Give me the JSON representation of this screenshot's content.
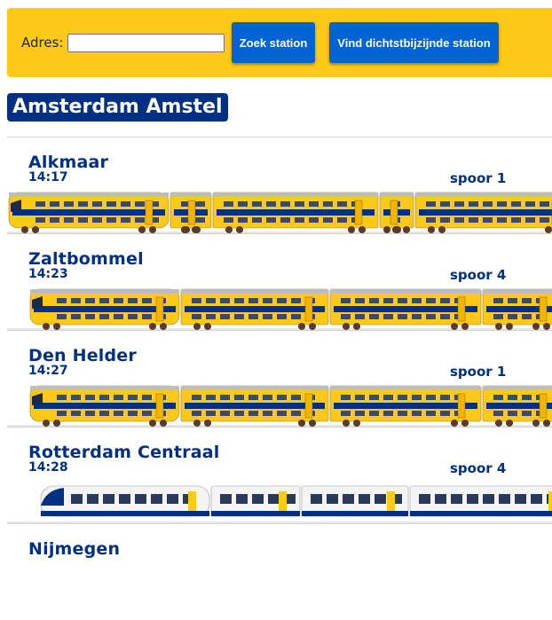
{
  "search": {
    "label": "Adres:",
    "input_value": "",
    "placeholder": "",
    "search_button": "Zoek station",
    "nearest_button": "Vind dichtstbijzijnde station"
  },
  "station": {
    "name": "Amsterdam Amstel"
  },
  "departures": [
    {
      "destination": "Alkmaar",
      "time": "14:17",
      "track": "spoor 1",
      "train": "virm-long"
    },
    {
      "destination": "Zaltbommel",
      "time": "14:23",
      "track": "spoor 4",
      "train": "virm"
    },
    {
      "destination": "Den Helder",
      "time": "14:27",
      "track": "spoor 1",
      "train": "virm"
    },
    {
      "destination": "Rotterdam Centraal",
      "time": "14:28",
      "track": "spoor 4",
      "train": "sng"
    },
    {
      "destination": "Nijmegen",
      "time": "",
      "track": "",
      "train": ""
    }
  ],
  "colors": {
    "ns_yellow": "#ffc917",
    "ns_blue": "#003082",
    "button_blue": "#0063d3"
  }
}
